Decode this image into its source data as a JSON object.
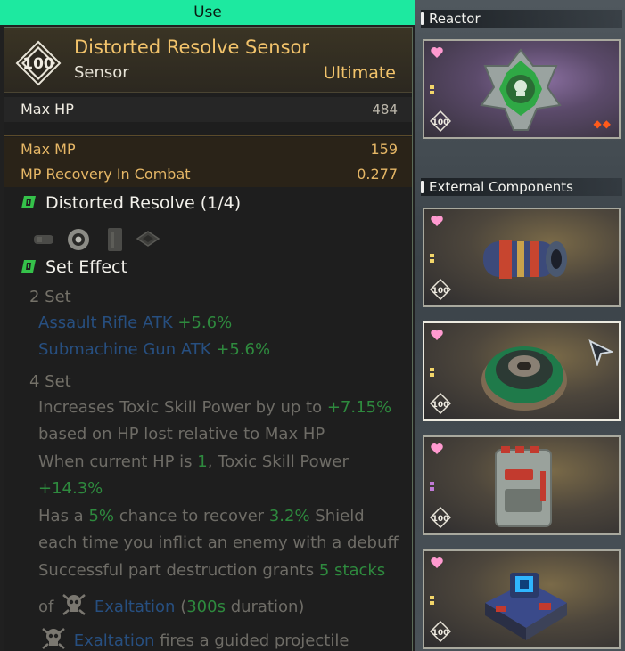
{
  "use_bar": {
    "label": "Use"
  },
  "item": {
    "level": "100",
    "name": "Distorted Resolve Sensor",
    "type": "Sensor",
    "rarity": "Ultimate"
  },
  "stats": {
    "max_hp": {
      "label": "Max HP",
      "value": "484"
    },
    "max_mp": {
      "label": "Max MP",
      "value": "159"
    },
    "mp_recovery": {
      "label": "MP Recovery In Combat",
      "value": "0.277"
    }
  },
  "set": {
    "name": "Distorted Resolve (1/4)",
    "effect_title": "Set Effect",
    "two_set": {
      "header": "2 Set",
      "ar_label": "Assault Rifle ATK",
      "ar_value": "+5.6%",
      "smg_label": "Submachine Gun ATK",
      "smg_value": "+5.6%"
    },
    "four_set": {
      "header": "4 Set",
      "l1a": "Increases Toxic Skill Power by up to",
      "l1b": "+7.15%",
      "l2": "based on HP lost relative to Max HP",
      "l3a": "When current HP is",
      "l3b": "1",
      "l3c": ", Toxic Skill Power",
      "l4": "+14.3%",
      "l5a": "Has a",
      "l5b": "5%",
      "l5c": "chance to recover",
      "l5d": "3.2%",
      "l5e": "Shield",
      "l6": "each time you inflict an enemy with a debuff",
      "l7a": "Successful part destruction grants",
      "l7b": "5 stacks",
      "l8a": "of",
      "l8b": "Exaltation",
      "l8c": "(",
      "l8d": "300s",
      "l8e": "duration)",
      "l9a": "Exaltation",
      "l9b": "fires a guided projectile"
    }
  },
  "right_panel": {
    "reactor_header": "Reactor",
    "external_header": "External Components",
    "slot_level": "100"
  },
  "colors": {
    "use_bar": "#1de9a0",
    "gold": "#f2c36b",
    "green_value": "#2e8a3e",
    "blue_keyword": "#274f80",
    "heart": "#ff9ad0"
  }
}
